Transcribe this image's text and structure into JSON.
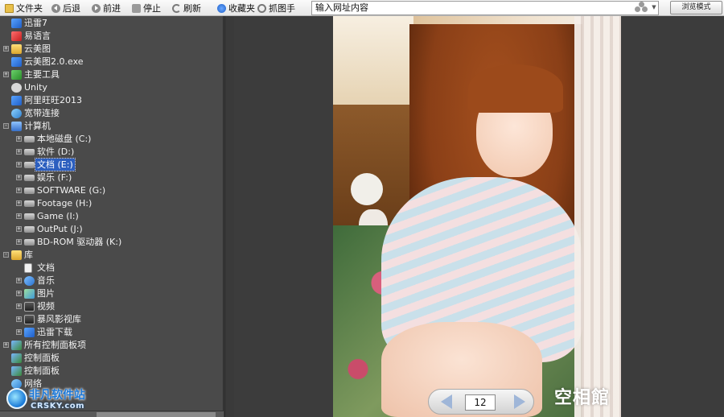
{
  "toolbar": {
    "file": "文件夹",
    "back": "后退",
    "forward": "前进",
    "stop": "停止",
    "refresh": "刷新",
    "favorites": "收藏夹",
    "capture": "抓图手",
    "address_placeholder": "输入网址内容",
    "mode_button": "浏览模式"
  },
  "tree": {
    "items": [
      {
        "label": "迅雷7",
        "depth": 0,
        "expander": "",
        "icon": "app"
      },
      {
        "label": "易语言",
        "depth": 0,
        "expander": "",
        "icon": "red"
      },
      {
        "label": "云美图",
        "depth": 0,
        "expander": "+",
        "icon": "folder"
      },
      {
        "label": "云美图2.0.exe",
        "depth": 0,
        "expander": "",
        "icon": "app"
      },
      {
        "label": "主要工具",
        "depth": 0,
        "expander": "+",
        "icon": "tool"
      },
      {
        "label": "Unity",
        "depth": 0,
        "expander": "",
        "icon": "unity"
      },
      {
        "label": "阿里旺旺2013",
        "depth": 0,
        "expander": "",
        "icon": "app"
      },
      {
        "label": "宽带连接",
        "depth": 0,
        "expander": "",
        "icon": "net"
      },
      {
        "label": "计算机",
        "depth": 0,
        "expander": "-",
        "icon": "pc"
      },
      {
        "label": "本地磁盘 (C:)",
        "depth": 1,
        "expander": "+",
        "icon": "drive"
      },
      {
        "label": "软件 (D:)",
        "depth": 1,
        "expander": "+",
        "icon": "drive"
      },
      {
        "label": "文档 (E:)",
        "depth": 1,
        "expander": "+",
        "icon": "drive",
        "selected": true
      },
      {
        "label": "娱乐 (F:)",
        "depth": 1,
        "expander": "+",
        "icon": "drive"
      },
      {
        "label": "SOFTWARE (G:)",
        "depth": 1,
        "expander": "+",
        "icon": "drive"
      },
      {
        "label": "Footage (H:)",
        "depth": 1,
        "expander": "+",
        "icon": "drive"
      },
      {
        "label": "Game (I:)",
        "depth": 1,
        "expander": "+",
        "icon": "drive"
      },
      {
        "label": "OutPut (J:)",
        "depth": 1,
        "expander": "+",
        "icon": "drive"
      },
      {
        "label": "BD-ROM 驱动器 (K:)",
        "depth": 1,
        "expander": "+",
        "icon": "drive"
      },
      {
        "label": "库",
        "depth": 0,
        "expander": "-",
        "icon": "folder"
      },
      {
        "label": "文档",
        "depth": 1,
        "expander": "",
        "icon": "doc"
      },
      {
        "label": "音乐",
        "depth": 1,
        "expander": "+",
        "icon": "music"
      },
      {
        "label": "图片",
        "depth": 1,
        "expander": "+",
        "icon": "pic"
      },
      {
        "label": "视频",
        "depth": 1,
        "expander": "+",
        "icon": "video"
      },
      {
        "label": "暴风影视库",
        "depth": 1,
        "expander": "+",
        "icon": "video"
      },
      {
        "label": "迅雷下载",
        "depth": 1,
        "expander": "+",
        "icon": "app"
      },
      {
        "label": "所有控制面板项",
        "depth": 0,
        "expander": "+",
        "icon": "ctrl"
      },
      {
        "label": "控制面板",
        "depth": 0,
        "expander": "",
        "icon": "ctrl"
      },
      {
        "label": "控制面板",
        "depth": 0,
        "expander": "",
        "icon": "ctrl"
      },
      {
        "label": "网络",
        "depth": 0,
        "expander": "",
        "icon": "net"
      }
    ]
  },
  "watermark": {
    "title": "非凡软件站",
    "subtitle": "CRSKY.com"
  },
  "viewer": {
    "page": "12",
    "photo_logo": "空相館"
  }
}
